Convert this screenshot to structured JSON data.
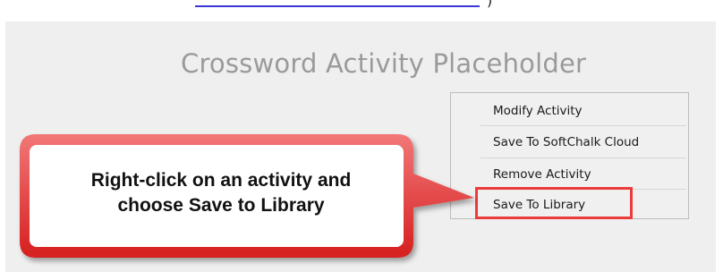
{
  "placeholder": {
    "title": "Crossword Activity Placeholder"
  },
  "top": {
    "paren": ")"
  },
  "context_menu": {
    "items": [
      {
        "label": "Modify Activity"
      },
      {
        "label": "Save To SoftChalk Cloud"
      },
      {
        "label": "Remove Activity"
      },
      {
        "label": "Save To Library"
      }
    ],
    "highlighted_item": "Save To Library"
  },
  "callout": {
    "line1": "Right-click on an activity and",
    "line2_prefix": "choose ",
    "line2_bold": "Save to Library",
    "fill_color": "#e83a3a",
    "inner_color": "#ffffff"
  }
}
